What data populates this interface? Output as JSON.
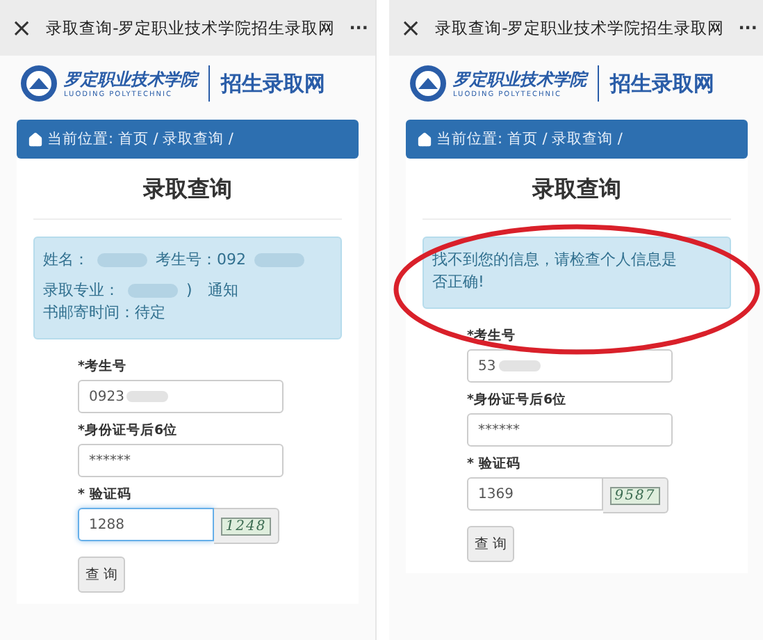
{
  "panels": [
    {
      "title_bar": {
        "close": "×",
        "title": "录取查询-罗定职业技术学院招生录取网",
        "more": "···"
      },
      "logo": {
        "name_cn": "罗定职业技术学院",
        "name_en": "LUODING POLYTECHNIC",
        "site": "招生录取网"
      },
      "breadcrumb": "当前位置: 首页 / 录取查询 /",
      "heading": "录取查询",
      "annotated": false,
      "alert": {
        "lines": [
          [
            {
              "kind": "text",
              "text": "姓名："
            },
            {
              "kind": "blur"
            },
            {
              "kind": "text",
              "text": "考生号：092"
            },
            {
              "kind": "blur"
            }
          ],
          [
            {
              "kind": "text",
              "text": "录取专业："
            },
            {
              "kind": "blur"
            },
            {
              "kind": "text",
              "text": ")　通知"
            }
          ],
          [
            {
              "kind": "text",
              "text": "书邮寄时间：待定"
            }
          ]
        ]
      },
      "fields": [
        {
          "label": "*考生号",
          "value": "0923",
          "blurred": true,
          "focused": false
        },
        {
          "label": "*身份证号后6位",
          "value": "******",
          "blurred": false,
          "focused": false
        }
      ],
      "captcha": {
        "label": "* 验证码",
        "value": "1288",
        "focused": true,
        "code": "1248"
      },
      "button": "查 询"
    },
    {
      "title_bar": {
        "close": "×",
        "title": "录取查询-罗定职业技术学院招生录取网",
        "more": "···"
      },
      "logo": {
        "name_cn": "罗定职业技术学院",
        "name_en": "LUODING POLYTECHNIC",
        "site": "招生录取网"
      },
      "breadcrumb": "当前位置: 首页 / 录取查询 /",
      "heading": "录取查询",
      "annotated": true,
      "alert": {
        "lines": [
          [
            {
              "kind": "text",
              "text": "找不到您的信息，请检查个人信息是"
            }
          ],
          [
            {
              "kind": "text",
              "text": "否正确!"
            }
          ]
        ]
      },
      "fields": [
        {
          "label": "*考生号",
          "value": "53",
          "blurred": true,
          "focused": false
        },
        {
          "label": "*身份证号后6位",
          "value": "******",
          "blurred": false,
          "focused": false
        }
      ],
      "captcha": {
        "label": "* 验证码",
        "value": "1369",
        "focused": false,
        "code": "9587"
      },
      "button": "查 询"
    }
  ]
}
